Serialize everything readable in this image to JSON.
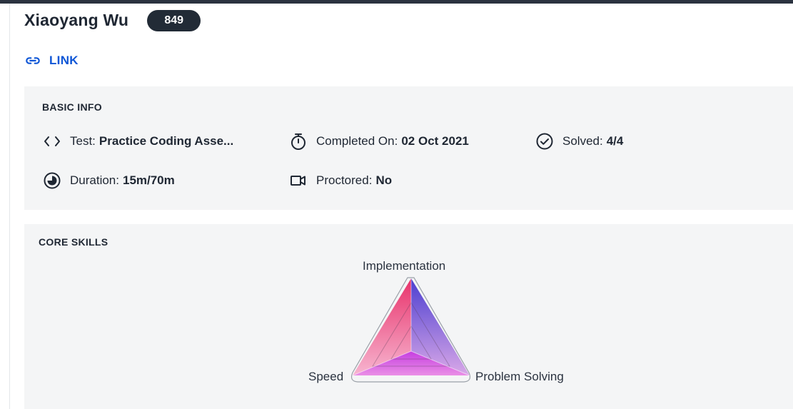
{
  "candidate": {
    "name": "Xiaoyang Wu",
    "score": "849"
  },
  "link": {
    "label": "LINK",
    "icon": "link-icon",
    "color": "#0e56d6"
  },
  "basic_info": {
    "title": "BASIC INFO",
    "test": {
      "label": "Test:",
      "value": "Practice Coding Asse...",
      "icon": "code-icon"
    },
    "completed": {
      "label": "Completed On:",
      "value": "02 Oct 2021",
      "icon": "stopwatch-icon"
    },
    "solved": {
      "label": "Solved:",
      "value": "4/4",
      "icon": "check-circle-icon"
    },
    "duration": {
      "label": "Duration:",
      "value": "15m/70m",
      "icon": "clock-pie-icon"
    },
    "proctored": {
      "label": "Proctored:",
      "value": "No",
      "icon": "video-camera-icon"
    }
  },
  "core_skills": {
    "title": "CORE SKILLS",
    "axes": [
      "Implementation",
      "Problem Solving",
      "Speed"
    ],
    "chart_data": {
      "type": "radar",
      "axes": [
        "Implementation",
        "Problem Solving",
        "Speed"
      ],
      "values": [
        1.0,
        1.0,
        1.0
      ],
      "range": [
        0,
        1
      ]
    },
    "colors": {
      "implementation": "#e8336b",
      "problem_solving": "#5b45d6",
      "speed": "#c53ee0"
    }
  }
}
